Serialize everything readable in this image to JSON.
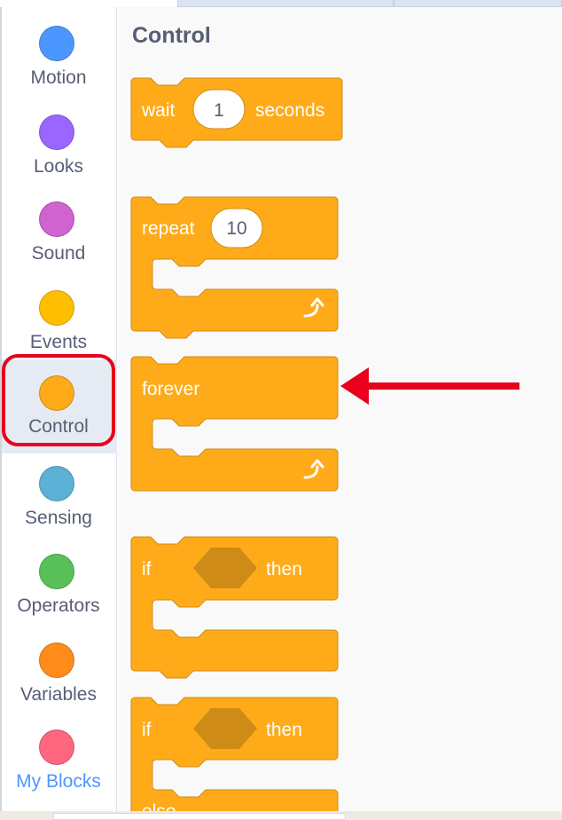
{
  "sidebar": {
    "categories": [
      {
        "label": "Motion",
        "color": "#4c97ff"
      },
      {
        "label": "Looks",
        "color": "#9966ff"
      },
      {
        "label": "Sound",
        "color": "#cf63cf"
      },
      {
        "label": "Events",
        "color": "#ffbf00"
      },
      {
        "label": "Control",
        "color": "#ffab19",
        "selected": true
      },
      {
        "label": "Sensing",
        "color": "#5cb1d6"
      },
      {
        "label": "Operators",
        "color": "#59c059"
      },
      {
        "label": "Variables",
        "color": "#ff8c1a"
      },
      {
        "label": "My Blocks",
        "color": "#ff6680"
      }
    ]
  },
  "palette": {
    "title": "Control",
    "block_color": "#ffab19",
    "block_border": "#cf8b17",
    "blocks": {
      "wait": {
        "label": "wait",
        "value": "1",
        "suffix": "seconds"
      },
      "repeat": {
        "label": "repeat",
        "value": "10"
      },
      "forever": {
        "label": "forever"
      },
      "if_then": {
        "label": "if",
        "suffix": "then"
      },
      "if_else": {
        "label": "if",
        "suffix": "then",
        "else_label": "else"
      }
    }
  },
  "annotation": {
    "arrow_color": "#e8001c",
    "highlight_color": "#e8001c"
  }
}
